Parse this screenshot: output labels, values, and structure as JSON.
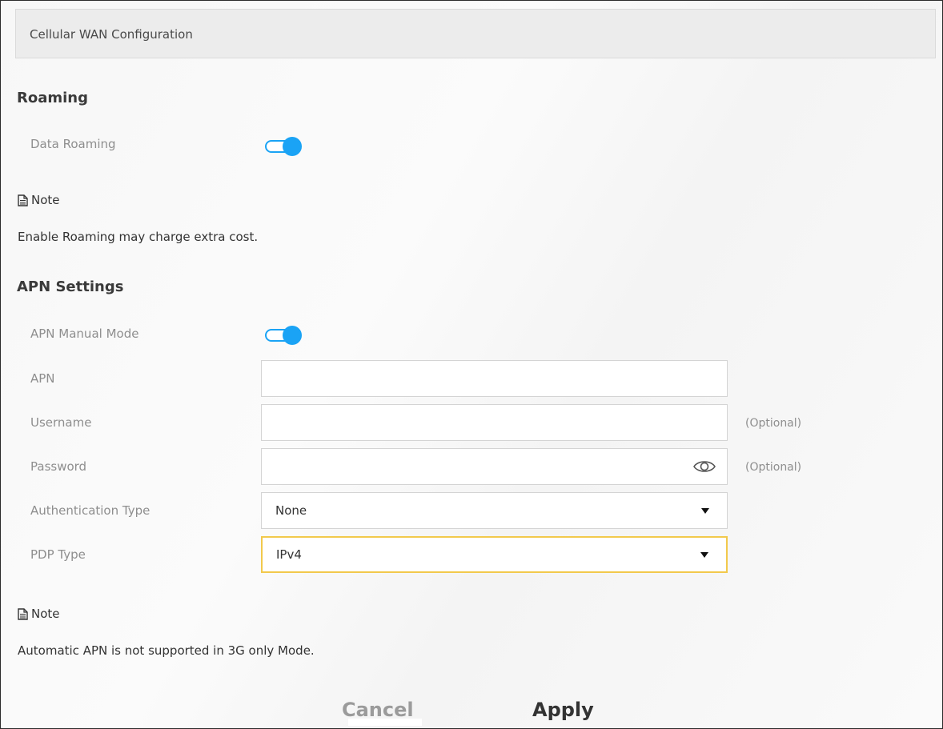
{
  "header": {
    "title": "Cellular WAN Configuration"
  },
  "roaming": {
    "title": "Roaming",
    "data_roaming_label": "Data Roaming",
    "data_roaming_enabled": true
  },
  "note1": {
    "heading": "Note",
    "text": "Enable Roaming may charge extra cost."
  },
  "apn": {
    "title": "APN Settings",
    "manual_mode_label": "APN Manual Mode",
    "manual_mode_enabled": true,
    "apn_label": "APN",
    "apn_value": "",
    "username_label": "Username",
    "username_value": "",
    "username_hint": "(Optional)",
    "password_label": "Password",
    "password_value": "",
    "password_hint": "(Optional)",
    "auth_type_label": "Authentication Type",
    "auth_type_value": "None",
    "pdp_type_label": "PDP Type",
    "pdp_type_value": "IPv4"
  },
  "note2": {
    "heading": "Note",
    "text": "Automatic APN is not supported in 3G only Mode."
  },
  "buttons": {
    "cancel": "Cancel",
    "apply": "Apply"
  },
  "colors": {
    "accent": "#1aa3f5",
    "highlight": "#ffc800",
    "focus_border": "#f2c94c"
  }
}
